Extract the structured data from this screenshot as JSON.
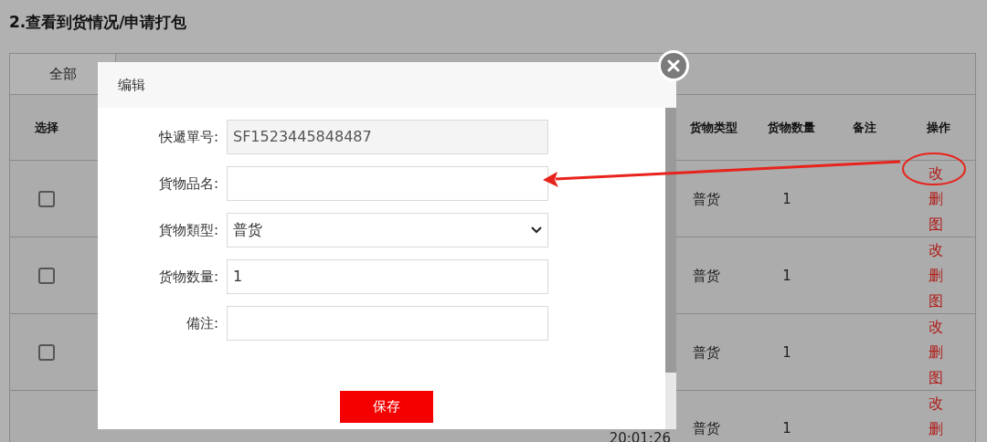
{
  "page": {
    "heading": "2.查看到货情况/申请打包"
  },
  "table": {
    "tabs": [
      {
        "label": "全部",
        "selected": true
      }
    ],
    "columns": [
      "选择",
      "货物类型",
      "货物数量",
      "备注",
      "操作"
    ],
    "rows": [
      {
        "checked": false,
        "type": "普货",
        "quantity": "1",
        "actions": [
          "改",
          "删",
          "图"
        ]
      },
      {
        "checked": false,
        "type": "普货",
        "quantity": "1",
        "actions": [
          "改",
          "删",
          "图"
        ]
      },
      {
        "checked": false,
        "type": "普货",
        "quantity": "1",
        "actions": [
          "改",
          "删",
          "图"
        ]
      },
      {
        "time": "20:01:26",
        "type": "普货",
        "quantity": "1",
        "actions": [
          "改",
          "删"
        ]
      }
    ]
  },
  "modal": {
    "title": "编辑",
    "fields": [
      {
        "kind": "readonly",
        "label": "快遞單号:",
        "value": "SF1523445848487"
      },
      {
        "kind": "text",
        "label": "貨物品名:"
      },
      {
        "kind": "select",
        "label": "貨物類型:",
        "value": "普货"
      },
      {
        "kind": "text",
        "label": "货物数量:",
        "value": "1"
      },
      {
        "kind": "text",
        "label": "備注:"
      }
    ],
    "save_button": "保存"
  }
}
